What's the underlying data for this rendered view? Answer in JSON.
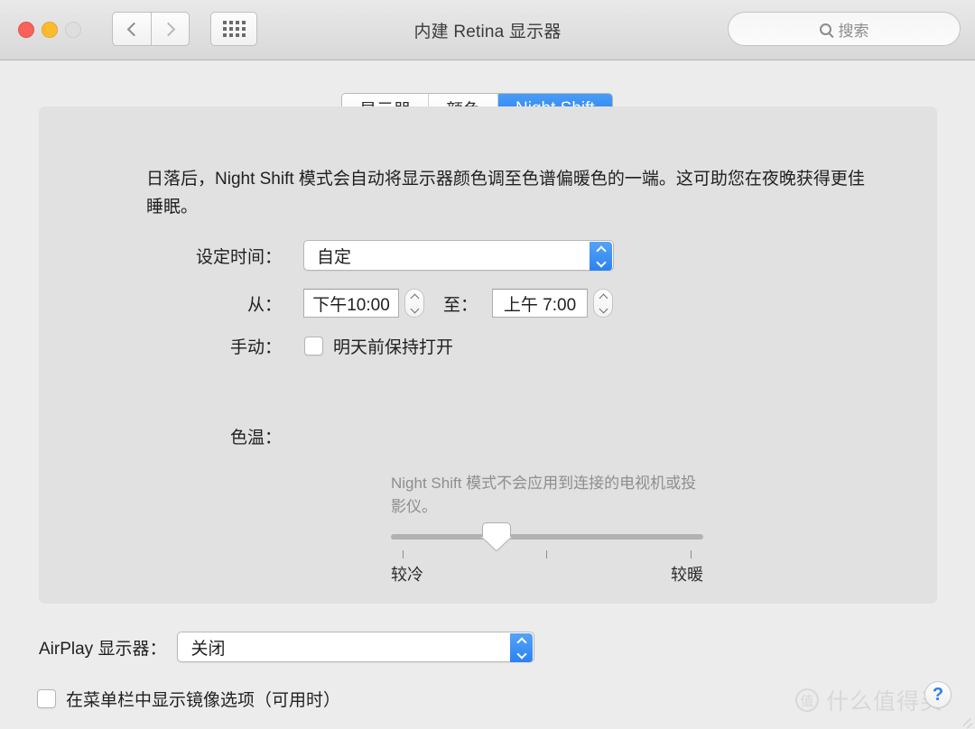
{
  "window": {
    "title": "内建 Retina 显示器",
    "traffic_lights": {
      "close": "close-button",
      "minimize": "minimize-button",
      "zoom": "zoom-button"
    },
    "nav": {
      "back_label": "‹",
      "forward_label": "›",
      "grid_label": "show-all"
    },
    "search": {
      "placeholder": "搜索",
      "value": ""
    }
  },
  "tabs": [
    {
      "label": "显示器",
      "selected": false
    },
    {
      "label": "颜色",
      "selected": false
    },
    {
      "label": "Night Shift",
      "selected": true
    }
  ],
  "night_shift": {
    "description": "日落后，Night Shift 模式会自动将显示器颜色调至色谱偏暖色的一端。这可助您在夜晚获得更佳睡眠。",
    "schedule": {
      "label": "设定时间：",
      "value": "自定"
    },
    "time_range": {
      "from_label": "从：",
      "from_value": "下午10:00",
      "to_label": "至：",
      "to_value": "上午 7:00"
    },
    "manual": {
      "label": "手动：",
      "checkbox_label": "明天前保持打开",
      "checked": false
    },
    "hint": "Night Shift 模式不会应用到连接的电视机或投影仪。",
    "temperature": {
      "label": "色温：",
      "cool_label": "较冷",
      "warm_label": "较暖",
      "value_percent": 34
    }
  },
  "airplay": {
    "label": "AirPlay 显示器：",
    "value": "关闭"
  },
  "mirror_option": {
    "label": "在菜单栏中显示镜像选项（可用时）",
    "checked": false
  },
  "help": {
    "label": "?"
  },
  "watermark": {
    "badge": "值",
    "text": "什么值得买"
  },
  "colors": {
    "accent": "#2a82f2",
    "window_bg": "#ececec",
    "panel_bg": "#e1e1e1",
    "close": "#f9625a",
    "minimize": "#fcbc2d",
    "zoom": "#dedede"
  }
}
